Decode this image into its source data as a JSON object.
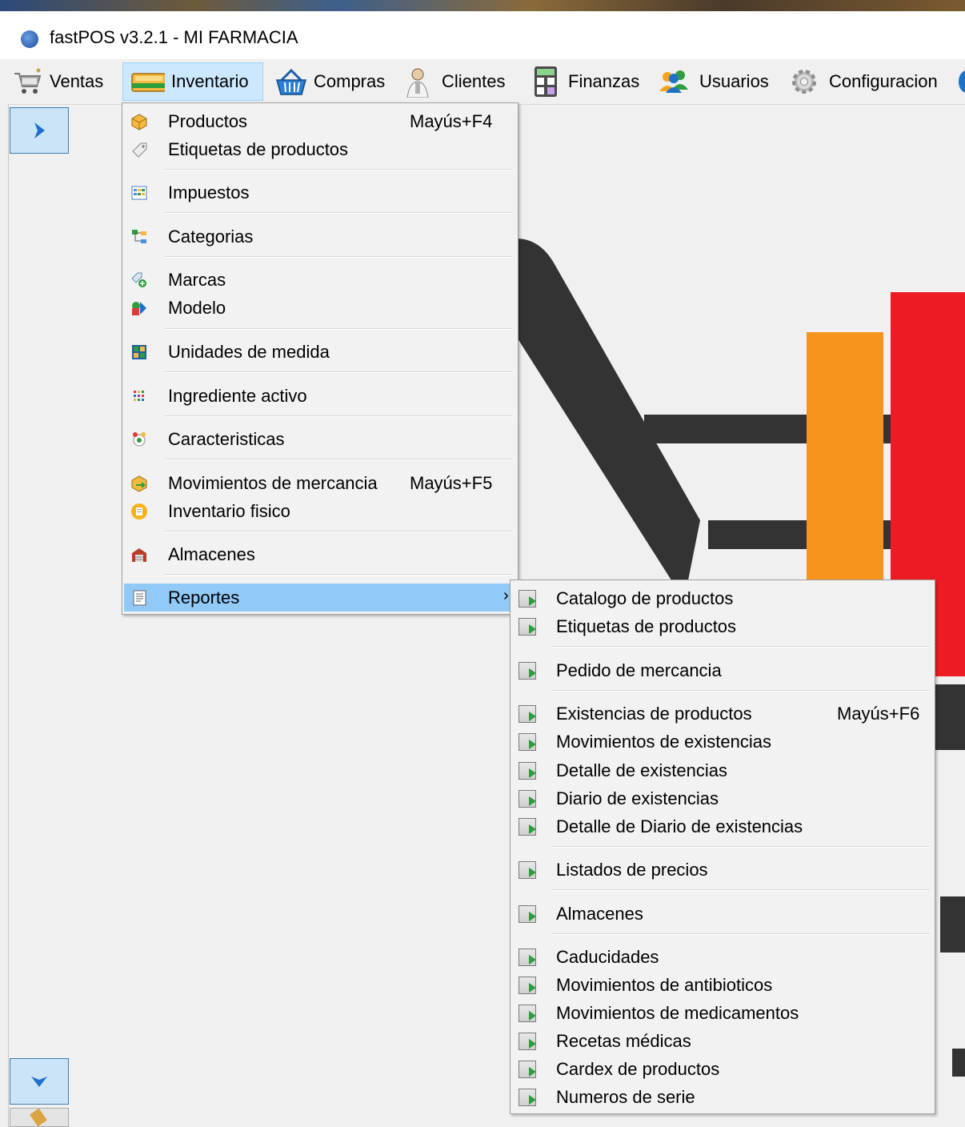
{
  "window": {
    "title": "fastPOS v3.2.1 - MI FARMACIA"
  },
  "menubar": {
    "items": [
      {
        "label": "Ventas",
        "icon": "shopping-cart-icon"
      },
      {
        "label": "Inventario",
        "icon": "inventory-box-icon"
      },
      {
        "label": "Compras",
        "icon": "basket-icon"
      },
      {
        "label": "Clientes",
        "icon": "customer-icon"
      },
      {
        "label": "Finanzas",
        "icon": "calculator-icon"
      },
      {
        "label": "Usuarios",
        "icon": "users-icon"
      },
      {
        "label": "Configuracion",
        "icon": "gear-icon"
      }
    ]
  },
  "inventario_menu": {
    "items": [
      {
        "label": "Productos",
        "shortcut": "Mayús+F4"
      },
      {
        "label": "Etiquetas de productos"
      },
      {
        "label": "Impuestos"
      },
      {
        "label": "Categorias"
      },
      {
        "label": "Marcas"
      },
      {
        "label": "Modelo"
      },
      {
        "label": "Unidades de medida"
      },
      {
        "label": "Ingrediente activo"
      },
      {
        "label": "Caracteristicas"
      },
      {
        "label": "Movimientos de mercancia",
        "shortcut": "Mayús+F5"
      },
      {
        "label": "Inventario fisico"
      },
      {
        "label": "Almacenes"
      },
      {
        "label": "Reportes",
        "submenu_arrow": "›"
      }
    ]
  },
  "reportes_menu": {
    "items": [
      {
        "label": "Catalogo de productos"
      },
      {
        "label": "Etiquetas de productos"
      },
      {
        "label": "Pedido de mercancia"
      },
      {
        "label": "Existencias de productos",
        "shortcut": "Mayús+F6"
      },
      {
        "label": "Movimientos de existencias"
      },
      {
        "label": "Detalle de existencias"
      },
      {
        "label": "Diario de existencias"
      },
      {
        "label": "Detalle de Diario de existencias"
      },
      {
        "label": "Listados de precios"
      },
      {
        "label": "Almacenes"
      },
      {
        "label": "Caducidades"
      },
      {
        "label": "Movimientos de antibioticos"
      },
      {
        "label": "Movimientos de medicamentos"
      },
      {
        "label": "Recetas médicas"
      },
      {
        "label": "Cardex de productos"
      },
      {
        "label": "Numeros de serie"
      }
    ]
  },
  "colors": {
    "highlight": "#91c9f7",
    "active_menu": "#cce8ff",
    "logo_red": "#ed1c24",
    "logo_orange": "#f7941d",
    "logo_dark": "#333333"
  }
}
